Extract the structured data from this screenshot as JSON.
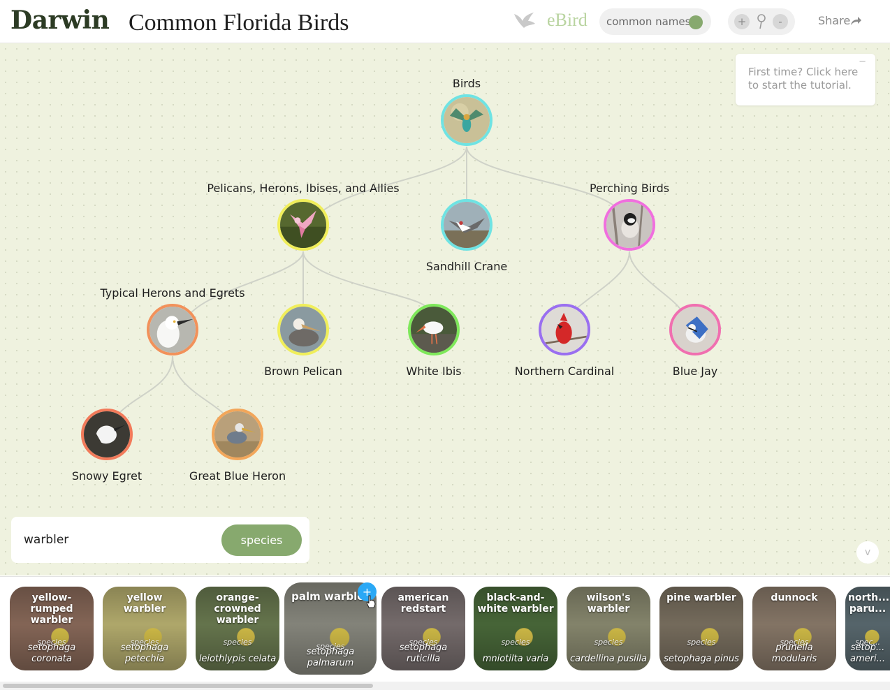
{
  "header": {
    "logo": "Darwin",
    "title": "Common Florida Birds",
    "ebird_label": "eBird",
    "names_toggle_label": "common names",
    "zoom_in_label": "+",
    "zoom_out_label": "-",
    "share_label": "Share"
  },
  "tutorial": {
    "text": "First time? Click here to start the tutorial.",
    "minimize_label": "−"
  },
  "tree": {
    "root": {
      "label": "Birds"
    },
    "nodes": [
      {
        "label": "Birds"
      },
      {
        "label": "Pelicans, Herons, Ibises, and Allies"
      },
      {
        "label": "Sandhill Crane"
      },
      {
        "label": "Perching Birds"
      },
      {
        "label": "Typical Herons and Egrets"
      },
      {
        "label": "Brown Pelican"
      },
      {
        "label": "White Ibis"
      },
      {
        "label": "Northern Cardinal"
      },
      {
        "label": "Blue Jay"
      },
      {
        "label": "Snowy Egret"
      },
      {
        "label": "Great Blue Heron"
      }
    ],
    "node_colors": {
      "birds": "#6fe3e3",
      "pelicans": "#f0ee5a",
      "crane": "#6fe3e3",
      "perching": "#f06fde",
      "typical_herons": "#f2915a",
      "brown_pelican": "#f0ee5a",
      "white_ibis": "#7ee85a",
      "cardinal": "#9a6ff0",
      "blue_jay": "#f06fb0",
      "snowy_egret": "#f27a5a",
      "great_blue_heron": "#f2a65a"
    }
  },
  "search": {
    "value": "warbler",
    "rank_button": "species"
  },
  "collapse_label": "v",
  "results": [
    {
      "name": "yellow-rumped warbler",
      "rank": "species",
      "sci": "setophaga coronata",
      "color": "#8a6a5a"
    },
    {
      "name": "yellow warbler",
      "rank": "species",
      "sci": "setophaga petechia",
      "color": "#b8b070"
    },
    {
      "name": "orange-crowned warbler",
      "rank": "species",
      "sci": "leiothlypis celata",
      "color": "#6a7a50"
    },
    {
      "name": "palm warbler",
      "rank": "species",
      "sci": "setophaga palmarum",
      "color": "#8a8a80"
    },
    {
      "name": "american redstart",
      "rank": "species",
      "sci": "setophaga ruticilla",
      "color": "#7a7070"
    },
    {
      "name": "black-and-white warbler",
      "rank": "species",
      "sci": "mniotilta varia",
      "color": "#4a6a3a"
    },
    {
      "name": "wilson's warbler",
      "rank": "species",
      "sci": "cardellina pusilla",
      "color": "#8a8a70"
    },
    {
      "name": "pine warbler",
      "rank": "species",
      "sci": "setophaga pinus",
      "color": "#7a7060"
    },
    {
      "name": "dunnock",
      "rank": "species",
      "sci": "prunella modularis",
      "color": "#8a7a6a"
    },
    {
      "name": "north... paru...",
      "rank": "spec...",
      "sci": "setop... ameri...",
      "color": "#5a6a70"
    }
  ],
  "hovered_result_add_label": "+"
}
